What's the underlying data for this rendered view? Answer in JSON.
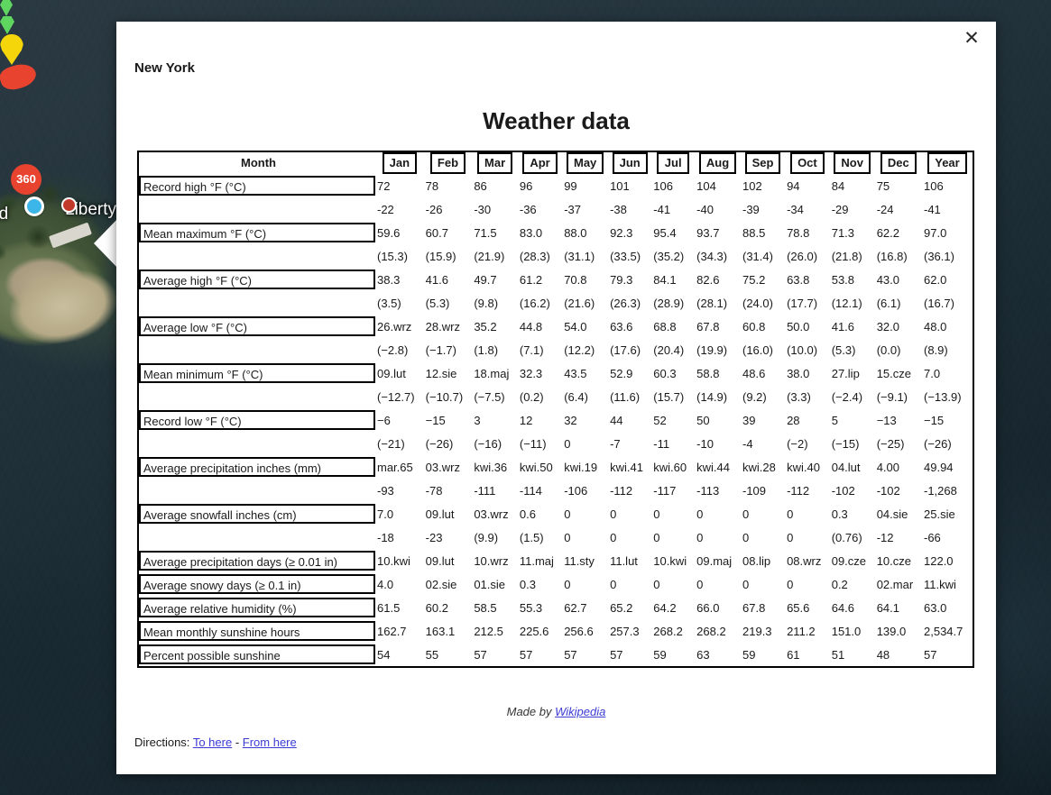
{
  "map": {
    "labels": [
      {
        "name": "island-label",
        "text": "nd"
      },
      {
        "name": "liberty-label",
        "text": "Liberty"
      }
    ],
    "markers": {
      "street_view_badge": "360"
    }
  },
  "info_window": {
    "close_icon": "close-icon",
    "close_glyph": "✕",
    "place_title": "New York",
    "heading": "Weather data",
    "made_by_prefix": "Made by ",
    "made_by_link": "Wikipedia",
    "directions_label": "Directions:",
    "directions_to": "To here",
    "directions_separator": "-",
    "directions_from": "From here"
  },
  "table": {
    "row_header_label": "Month",
    "columns": [
      "Jan",
      "Feb",
      "Mar",
      "Apr",
      "May",
      "Jun",
      "Jul",
      "Aug",
      "Sep",
      "Oct",
      "Nov",
      "Dec",
      "Year"
    ],
    "rows": [
      {
        "label": "Record high °F (°C)",
        "primary": [
          "72",
          "78",
          "86",
          "96",
          "99",
          "101",
          "106",
          "104",
          "102",
          "94",
          "84",
          "75",
          "106"
        ],
        "secondary": [
          "-22",
          "-26",
          "-30",
          "-36",
          "-37",
          "-38",
          "-41",
          "-40",
          "-39",
          "-34",
          "-29",
          "-24",
          "-41"
        ]
      },
      {
        "label": "Mean maximum °F (°C)",
        "primary": [
          "59.6",
          "60.7",
          "71.5",
          "83.0",
          "88.0",
          "92.3",
          "95.4",
          "93.7",
          "88.5",
          "78.8",
          "71.3",
          "62.2",
          "97.0"
        ],
        "secondary": [
          "(15.3)",
          "(15.9)",
          "(21.9)",
          "(28.3)",
          "(31.1)",
          "(33.5)",
          "(35.2)",
          "(34.3)",
          "(31.4)",
          "(26.0)",
          "(21.8)",
          "(16.8)",
          "(36.1)"
        ]
      },
      {
        "label": "Average high °F (°C)",
        "primary": [
          "38.3",
          "41.6",
          "49.7",
          "61.2",
          "70.8",
          "79.3",
          "84.1",
          "82.6",
          "75.2",
          "63.8",
          "53.8",
          "43.0",
          "62.0"
        ],
        "secondary": [
          "(3.5)",
          "(5.3)",
          "(9.8)",
          "(16.2)",
          "(21.6)",
          "(26.3)",
          "(28.9)",
          "(28.1)",
          "(24.0)",
          "(17.7)",
          "(12.1)",
          "(6.1)",
          "(16.7)"
        ]
      },
      {
        "label": "Average low °F (°C)",
        "primary": [
          "26.wrz",
          "28.wrz",
          "35.2",
          "44.8",
          "54.0",
          "63.6",
          "68.8",
          "67.8",
          "60.8",
          "50.0",
          "41.6",
          "32.0",
          "48.0"
        ],
        "secondary": [
          "(−2.8)",
          "(−1.7)",
          "(1.8)",
          "(7.1)",
          "(12.2)",
          "(17.6)",
          "(20.4)",
          "(19.9)",
          "(16.0)",
          "(10.0)",
          "(5.3)",
          "(0.0)",
          "(8.9)"
        ]
      },
      {
        "label": "Mean minimum °F (°C)",
        "primary": [
          "09.lut",
          "12.sie",
          "18.maj",
          "32.3",
          "43.5",
          "52.9",
          "60.3",
          "58.8",
          "48.6",
          "38.0",
          "27.lip",
          "15.cze",
          "7.0"
        ],
        "secondary": [
          "(−12.7)",
          "(−10.7)",
          "(−7.5)",
          "(0.2)",
          "(6.4)",
          "(11.6)",
          "(15.7)",
          "(14.9)",
          "(9.2)",
          "(3.3)",
          "(−2.4)",
          "(−9.1)",
          "(−13.9)"
        ]
      },
      {
        "label": "Record low °F (°C)",
        "primary": [
          "−6",
          "−15",
          "3",
          "12",
          "32",
          "44",
          "52",
          "50",
          "39",
          "28",
          "5",
          "−13",
          "−15"
        ],
        "secondary": [
          "(−21)",
          "(−26)",
          "(−16)",
          "(−11)",
          "0",
          "-7",
          "-11",
          "-10",
          "-4",
          "(−2)",
          "(−15)",
          "(−25)",
          "(−26)"
        ]
      },
      {
        "label": "Average precipitation inches (mm)",
        "primary": [
          "mar.65",
          "03.wrz",
          "kwi.36",
          "kwi.50",
          "kwi.19",
          "kwi.41",
          "kwi.60",
          "kwi.44",
          "kwi.28",
          "kwi.40",
          "04.lut",
          "4.00",
          "49.94"
        ],
        "secondary": [
          "-93",
          "-78",
          "-111",
          "-114",
          "-106",
          "-112",
          "-117",
          "-113",
          "-109",
          "-112",
          "-102",
          "-102",
          "-1,268"
        ]
      },
      {
        "label": "Average snowfall inches (cm)",
        "primary": [
          "7.0",
          "09.lut",
          "03.wrz",
          "0.6",
          "0",
          "0",
          "0",
          "0",
          "0",
          "0",
          "0.3",
          "04.sie",
          "25.sie"
        ],
        "secondary": [
          "-18",
          "-23",
          "(9.9)",
          "(1.5)",
          "0",
          "0",
          "0",
          "0",
          "0",
          "0",
          "(0.76)",
          "-12",
          "-66"
        ]
      },
      {
        "label": "Average precipitation days (≥ 0.01 in)",
        "primary": [
          "10.kwi",
          "09.lut",
          "10.wrz",
          "11.maj",
          "11.sty",
          "11.lut",
          "10.kwi",
          "09.maj",
          "08.lip",
          "08.wrz",
          "09.cze",
          "10.cze",
          "122.0"
        ],
        "secondary": null
      },
      {
        "label": "Average snowy days (≥ 0.1 in)",
        "primary": [
          "4.0",
          "02.sie",
          "01.sie",
          "0.3",
          "0",
          "0",
          "0",
          "0",
          "0",
          "0",
          "0.2",
          "02.mar",
          "11.kwi"
        ],
        "secondary": null
      },
      {
        "label": "Average relative humidity (%)",
        "primary": [
          "61.5",
          "60.2",
          "58.5",
          "55.3",
          "62.7",
          "65.2",
          "64.2",
          "66.0",
          "67.8",
          "65.6",
          "64.6",
          "64.1",
          "63.0"
        ],
        "secondary": null
      },
      {
        "label": "Mean monthly sunshine hours",
        "primary": [
          "162.7",
          "163.1",
          "212.5",
          "225.6",
          "256.6",
          "257.3",
          "268.2",
          "268.2",
          "219.3",
          "211.2",
          "151.0",
          "139.0",
          "2,534.7"
        ],
        "secondary": null
      },
      {
        "label": "Percent possible sunshine",
        "primary": [
          "54",
          "55",
          "57",
          "57",
          "57",
          "57",
          "59",
          "63",
          "59",
          "61",
          "51",
          "48",
          "57"
        ],
        "secondary": null
      }
    ]
  },
  "colors": {
    "link": "#3b3bd6",
    "text": "#1a1a1a",
    "border": "#000000",
    "marker_yellow": "#f5d60b",
    "marker_red": "#e8432f",
    "marker_green": "#5fd65f",
    "marker_blue": "#3cb5e8"
  }
}
